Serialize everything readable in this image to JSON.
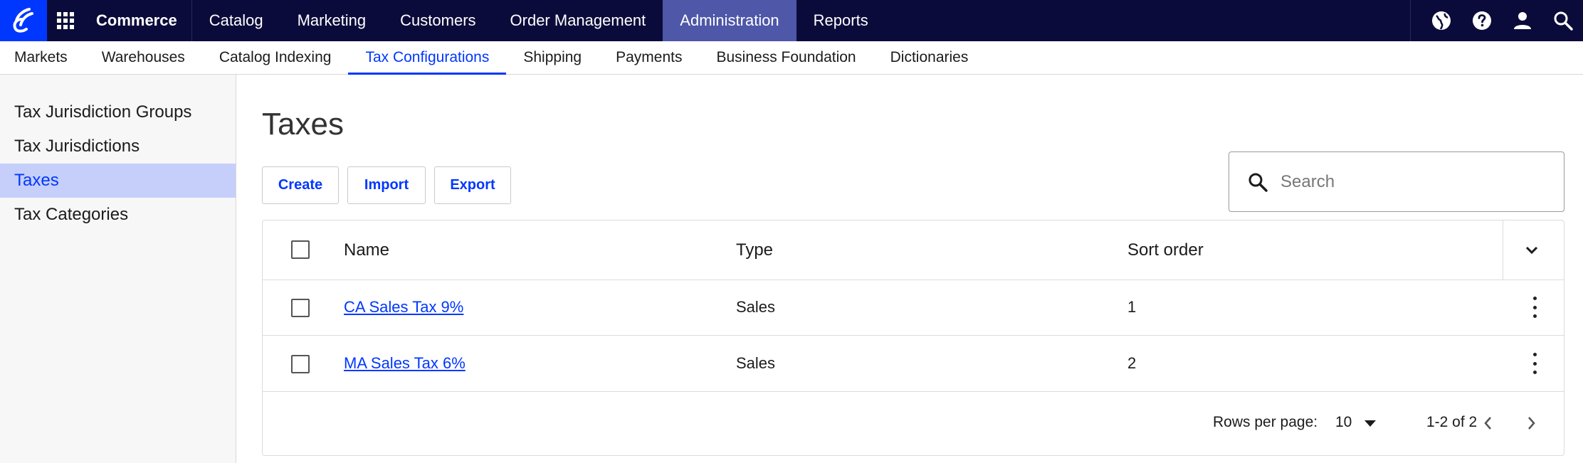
{
  "topnav": {
    "brand": "Commerce",
    "items": [
      "Catalog",
      "Marketing",
      "Customers",
      "Order Management",
      "Administration",
      "Reports"
    ],
    "active": "Administration"
  },
  "subnav": {
    "items": [
      "Markets",
      "Warehouses",
      "Catalog Indexing",
      "Tax Configurations",
      "Shipping",
      "Payments",
      "Business Foundation",
      "Dictionaries"
    ],
    "active": "Tax Configurations"
  },
  "sidebar": {
    "items": [
      "Tax Jurisdiction Groups",
      "Tax Jurisdictions",
      "Taxes",
      "Tax Categories"
    ],
    "active": "Taxes"
  },
  "main": {
    "title": "Taxes",
    "buttons": {
      "create": "Create",
      "import": "Import",
      "export": "Export"
    },
    "search": {
      "placeholder": "Search"
    }
  },
  "table": {
    "columns": {
      "name": "Name",
      "type": "Type",
      "sort_order": "Sort order"
    },
    "rows": [
      {
        "name": "CA Sales Tax 9%",
        "type": "Sales",
        "sort_order": "1"
      },
      {
        "name": "MA Sales Tax 6%",
        "type": "Sales",
        "sort_order": "2"
      }
    ],
    "footer": {
      "rows_per_page_label": "Rows per page:",
      "rows_per_page": "10",
      "range": "1-2 of 2"
    }
  },
  "colors": {
    "nav_bg": "#0b0b3b",
    "accent": "#0037ff",
    "nav_active": "#4e57a8",
    "sidebar_active": "#c6cffa"
  },
  "icons": [
    "brand-logo-icon",
    "apps-grid-icon",
    "globe-icon",
    "help-icon",
    "user-icon",
    "search-icon",
    "chevron-down-icon",
    "kebab-menu-icon",
    "caret-down-icon",
    "chevron-left-icon",
    "chevron-right-icon"
  ]
}
